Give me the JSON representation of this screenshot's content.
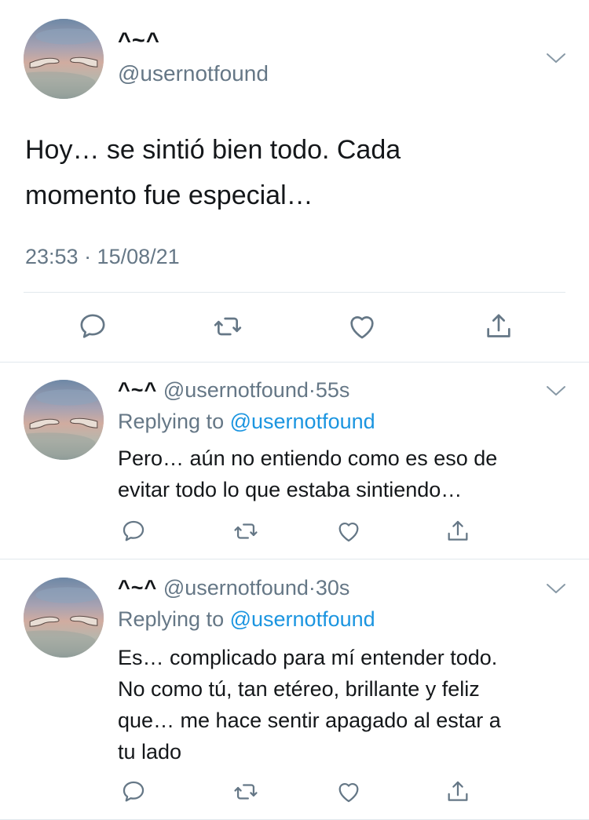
{
  "main_tweet": {
    "display_name": "^~^",
    "handle": "@usernotfound",
    "text_lines": [
      "Hoy… se sintió bien todo. Cada",
      "momento fue especial…"
    ],
    "timestamp": "23:53 · 15/08/21",
    "actions": [
      "reply-icon",
      "retweet-icon",
      "like-icon",
      "share-icon"
    ]
  },
  "replies": [
    {
      "display_name": "^~^",
      "handle": "@usernotfound",
      "time": "55s",
      "separator": "·",
      "replying_prefix": "Replying to",
      "replying_to": "@usernotfound",
      "text_lines": [
        "Pero… aún no entiendo como es eso de",
        "evitar todo lo que estaba sintiendo…"
      ]
    },
    {
      "display_name": "^~^",
      "handle": "@usernotfound",
      "time": "30s",
      "separator": "·",
      "replying_prefix": "Replying to",
      "replying_to": "@usernotfound",
      "text_lines": [
        "Es… complicado para mí entender todo.",
        "No como tú, tan etéreo, brillante y feliz",
        "que… me hace sentir apagado al estar a",
        "tu lado"
      ]
    }
  ],
  "colors": {
    "text": "#14171a",
    "muted": "#657786",
    "link": "#1b95e0",
    "divider": "#e1e8ed"
  }
}
